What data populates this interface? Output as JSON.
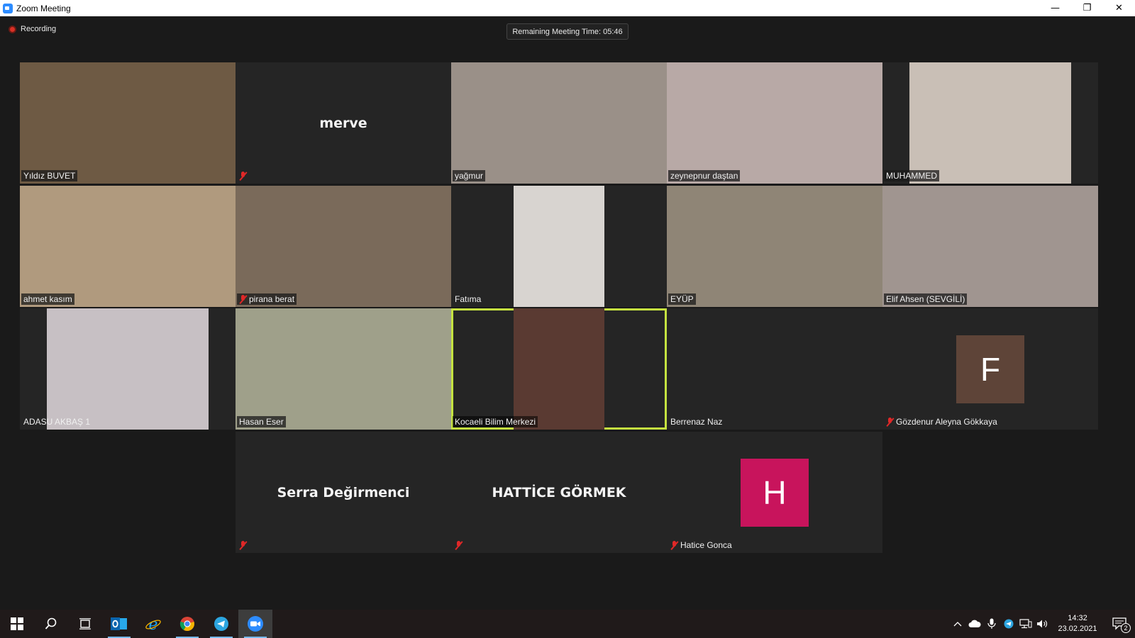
{
  "window": {
    "title": "Zoom Meeting",
    "minimize": "—",
    "restore": "❐",
    "close": "✕"
  },
  "meeting": {
    "recording_label": "Recording",
    "remaining_time": "Remaining Meeting Time: 05:46"
  },
  "participants": [
    {
      "name": "Yıldız BUVET",
      "muted": false,
      "display": "video",
      "video_color": "#6e5a44"
    },
    {
      "name": "merve",
      "muted": true,
      "display": "name"
    },
    {
      "name": "yağmur",
      "muted": false,
      "display": "video",
      "video_color": "#9a9088"
    },
    {
      "name": "zeynepnur daştan",
      "muted": false,
      "display": "video",
      "video_color": "#b8a9a6"
    },
    {
      "name": "MUHAMMED",
      "muted": false,
      "display": "video",
      "video_color": "#c9bfb6"
    },
    {
      "name": "ahmet kasım",
      "muted": false,
      "display": "video",
      "video_color": "#b09a7e"
    },
    {
      "name": "pirana  berat",
      "muted": true,
      "display": "video",
      "video_color": "#7a6a5a"
    },
    {
      "name": "Fatıma",
      "muted": false,
      "display": "video",
      "video_color": "#d8d4d0"
    },
    {
      "name": "EYÜP",
      "muted": false,
      "display": "video",
      "video_color": "#8f8576"
    },
    {
      "name": "Elif Ahsen (SEVGİLİ)",
      "muted": false,
      "display": "video",
      "video_color": "#a09590"
    },
    {
      "name": "ADASU  AKBAŞ 1",
      "muted": false,
      "display": "video",
      "video_color": "#c7c0c4"
    },
    {
      "name": "Hasan Eser",
      "muted": false,
      "display": "video",
      "video_color": "#9fa08a"
    },
    {
      "name": "Kocaeli Bilim Merkezi",
      "muted": false,
      "display": "video",
      "video_color": "#5a3a32",
      "active_speaker": true
    },
    {
      "name": "Berrenaz Naz",
      "muted": false,
      "display": "blank"
    },
    {
      "name": "Gözdenur Aleyna Gökkaya",
      "muted": true,
      "display": "avatar",
      "initial": "F",
      "avatar_color": "#5e4438"
    },
    {
      "name": "Serra Değirmenci",
      "muted": true,
      "display": "name"
    },
    {
      "name": "HATTİCE GÖRMEK",
      "muted": true,
      "display": "name"
    },
    {
      "name": "Hatice Gonca",
      "muted": true,
      "display": "avatar",
      "initial": "H",
      "avatar_color": "#c8145c"
    }
  ],
  "taskbar": {
    "apps": [
      {
        "name": "start",
        "icon": "windows-logo-icon"
      },
      {
        "name": "search",
        "icon": "search-icon"
      },
      {
        "name": "task-view",
        "icon": "task-view-icon"
      },
      {
        "name": "outlook",
        "icon": "outlook-icon"
      },
      {
        "name": "edge",
        "icon": "internet-explorer-icon"
      },
      {
        "name": "chrome",
        "icon": "chrome-icon"
      },
      {
        "name": "telegram",
        "icon": "telegram-icon"
      },
      {
        "name": "zoom",
        "icon": "zoom-icon"
      }
    ],
    "time": "14:32",
    "date": "23.02.2021",
    "notification_count": "2"
  }
}
